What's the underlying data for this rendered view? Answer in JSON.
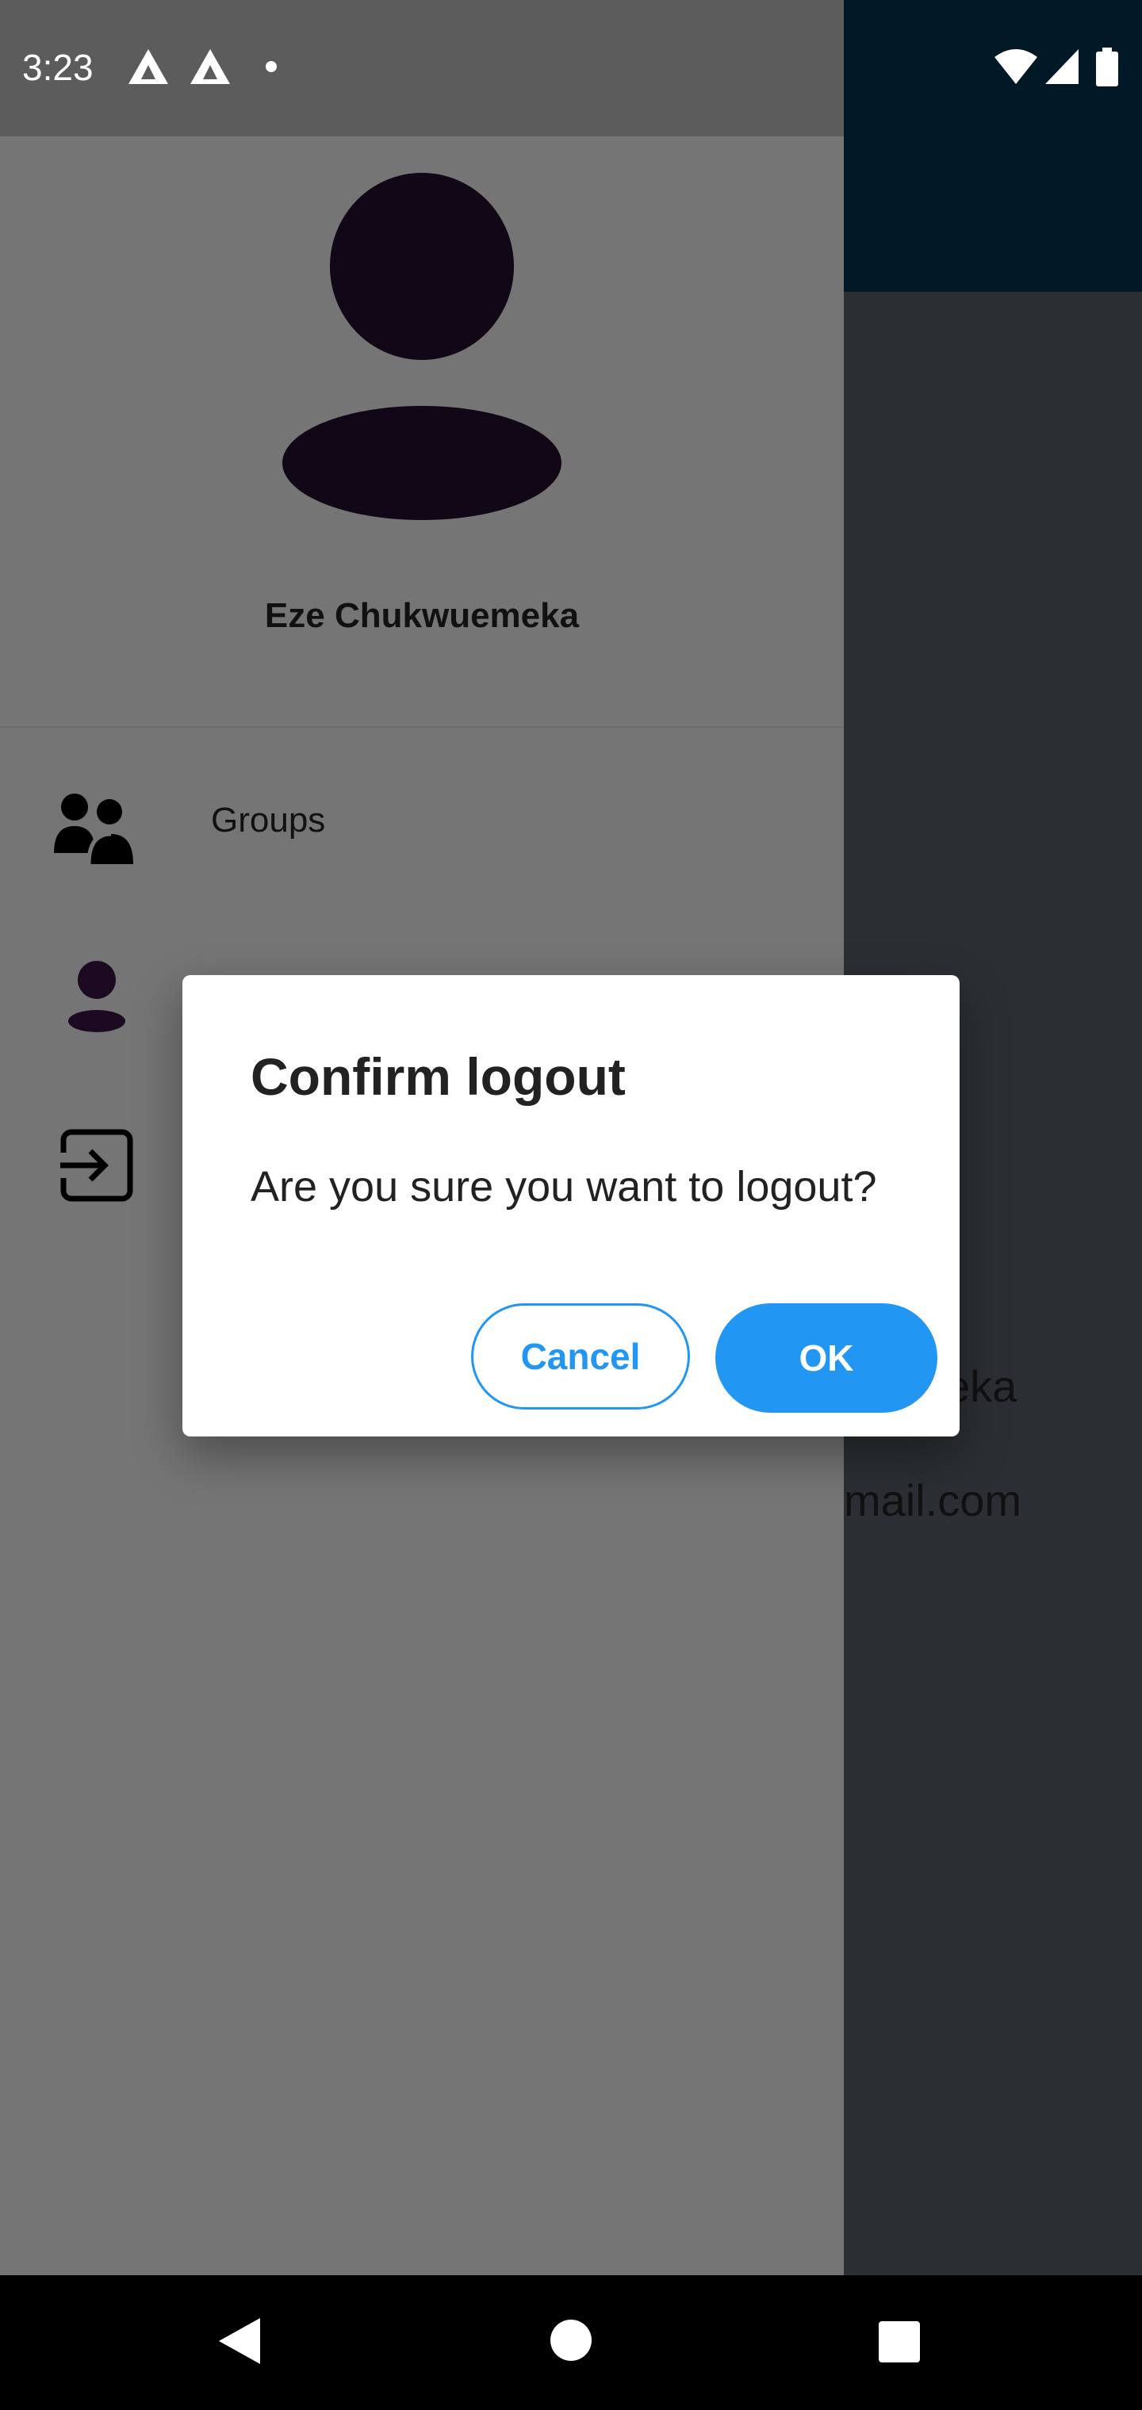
{
  "status_bar": {
    "time": "3:23",
    "icons": [
      "notification-a-icon",
      "notification-a-icon",
      "dot-icon",
      "wifi-icon",
      "cell-signal-icon",
      "battery-icon"
    ]
  },
  "background_screen": {
    "name_fragment": "eka",
    "email_fragment": "mail.com"
  },
  "drawer": {
    "user_name": "Eze Chukwuemeka",
    "items": [
      {
        "label": "Groups",
        "icon": "groups-icon"
      },
      {
        "label": "",
        "icon": "profile-icon"
      },
      {
        "label": "",
        "icon": "logout-icon"
      }
    ]
  },
  "dialog": {
    "title": "Confirm logout",
    "message": "Are you sure you want to logout?",
    "cancel_label": "Cancel",
    "ok_label": "OK"
  },
  "colors": {
    "accent": "#2196f3",
    "drawer_bg": "#757575",
    "app_bar": "#011827"
  },
  "nav_bar": {
    "buttons": [
      "back-icon",
      "home-icon",
      "recents-icon"
    ]
  }
}
